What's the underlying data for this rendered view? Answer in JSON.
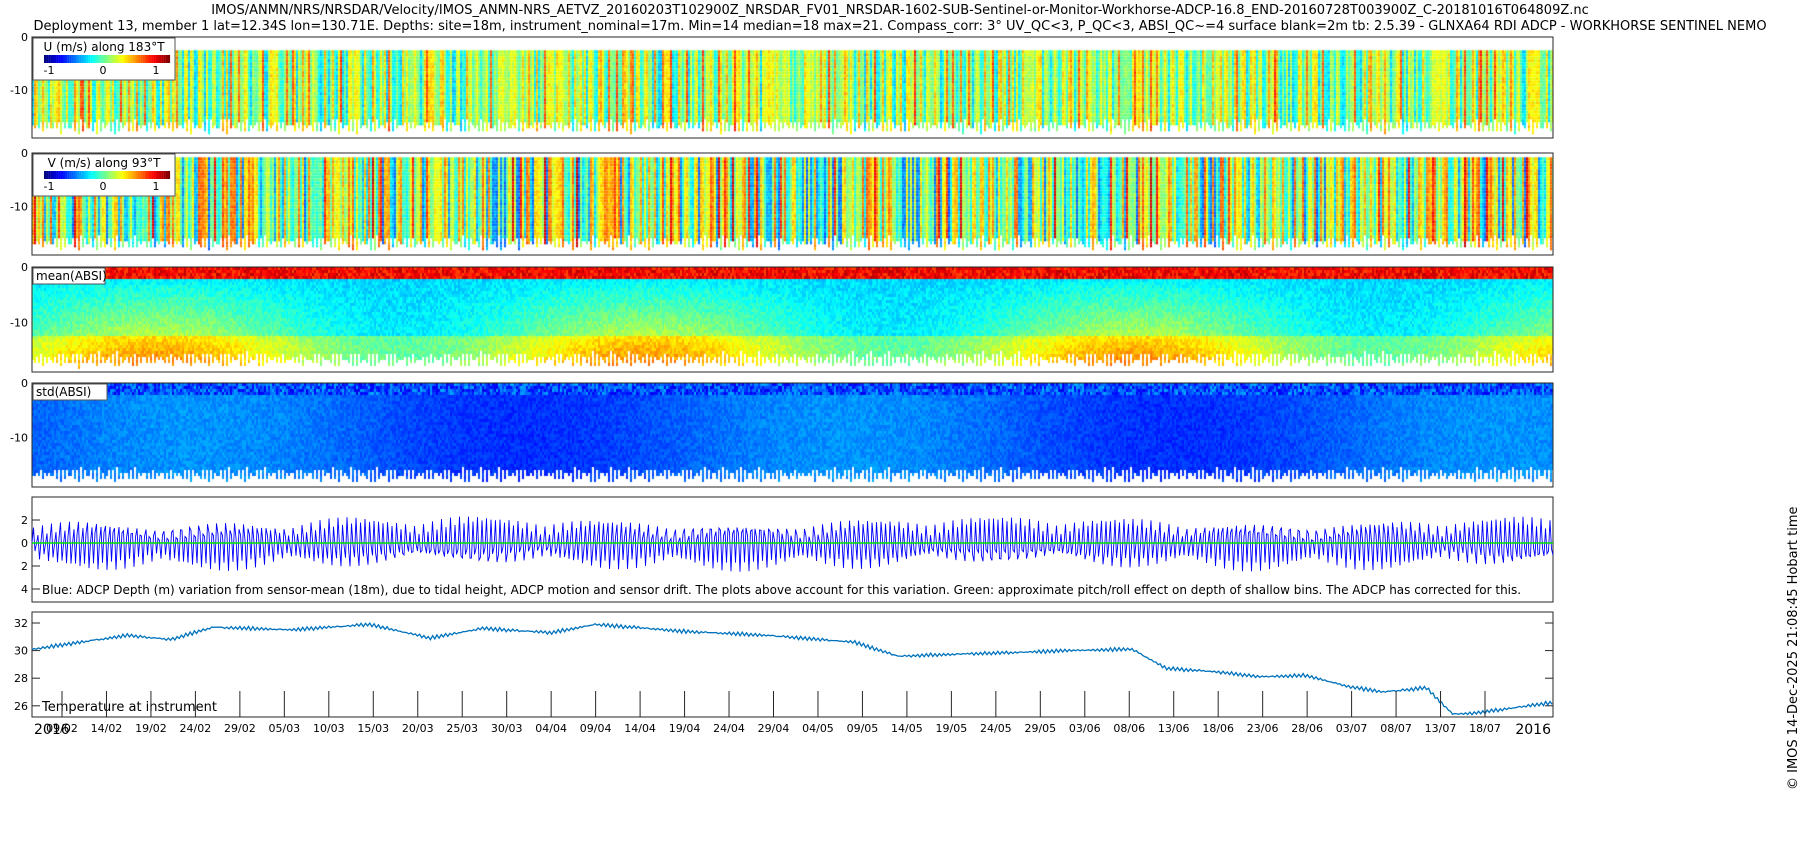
{
  "header": {
    "title": "IMOS/ANMN/NRS/NRSDAR/Velocity/IMOS_ANMN-NRS_AETVZ_20160203T102900Z_NRSDAR_FV01_NRSDAR-1602-SUB-Sentinel-or-Monitor-Workhorse-ADCP-16.8_END-20160728T003900Z_C-20181016T064809Z.nc",
    "subtitle": "Deployment 13, member 1 lat=12.34S lon=130.71E. Depths: site=18m, instrument_nominal=17m. Min=14 median=18 max=21. Compass_corr: 3° UV_QC<3, P_QC<3, ABSI_QC~=4 surface blank=2m tb: 2.5.39 - GLNXA64 RDI ADCP - WORKHORSE SENTINEL NEMO"
  },
  "credit": "© IMOS 14-Dec-2025 21:08:45 Hobart time",
  "chart_data": [
    {
      "type": "heatmap",
      "name": "U",
      "label": "U (m/s) along 183°T",
      "colorbar_ticks": [
        "-1",
        "0",
        "1"
      ],
      "clim": [
        -1.3,
        1.3
      ],
      "yticks": [
        "0",
        "-10"
      ],
      "ylim": [
        -19,
        0
      ],
      "colormap": "jet"
    },
    {
      "type": "heatmap",
      "name": "V",
      "label": "V (m/s) along 93°T",
      "colorbar_ticks": [
        "-1",
        "0",
        "1"
      ],
      "clim": [
        -1.3,
        1.3
      ],
      "yticks": [
        "0",
        "-10"
      ],
      "ylim": [
        -19,
        0
      ],
      "colormap": "jet"
    },
    {
      "type": "heatmap",
      "name": "meanABSI",
      "label": "mean(ABSI)",
      "yticks": [
        "0",
        "-10"
      ],
      "ylim": [
        -19,
        0
      ],
      "colormap": "jet"
    },
    {
      "type": "heatmap",
      "name": "stdABSI",
      "label": "std(ABSI)",
      "yticks": [
        "0",
        "-10"
      ],
      "ylim": [
        -19,
        0
      ],
      "colormap": "jet"
    },
    {
      "type": "line",
      "name": "depth",
      "yticks": [
        "2",
        "0",
        "2",
        "4"
      ],
      "ylim": [
        -4.5,
        3.8
      ],
      "series": [
        {
          "name": "ADCP depth variation",
          "color": "#0000ff",
          "amplitude_envelope_m": [
            2.2,
            3.3,
            1.0,
            2.9,
            1.2,
            3.3,
            1.0,
            3.0,
            1.1,
            3.4,
            1.0,
            2.9,
            1.0,
            3.2,
            1.0,
            2.8,
            1.0,
            2.8,
            1.0,
            2.9,
            1.0,
            3.0,
            1.0,
            2.9
          ]
        },
        {
          "name": "pitch/roll effect",
          "color": "#00e000"
        }
      ],
      "annotation": "Blue: ADCP Depth (m) variation from sensor-mean (18m), due to tidal height, ADCP motion and sensor drift. The plots above account for this variation. Green: approximate pitch/roll effect on depth of shallow bins. The ADCP has corrected for this."
    },
    {
      "type": "line",
      "name": "temperature",
      "label": "Temperature at instrument",
      "yticks": [
        "32",
        "30",
        "28",
        "26"
      ],
      "ylim": [
        25.2,
        32.8
      ],
      "color": "#0072bd",
      "x_days_from_start": [
        0,
        11,
        16,
        21,
        30,
        39,
        46,
        52,
        60,
        65,
        75,
        85,
        95,
        100,
        110,
        120,
        127,
        131,
        136,
        142,
        147,
        152,
        156,
        161,
        164,
        167,
        175
      ],
      "values": [
        30.1,
        31.1,
        30.8,
        31.7,
        31.5,
        31.9,
        30.9,
        31.6,
        31.3,
        31.9,
        31.4,
        31.1,
        30.6,
        29.6,
        29.8,
        30.0,
        30.1,
        28.7,
        28.5,
        28.1,
        28.2,
        27.4,
        27.0,
        27.3,
        25.4,
        25.5,
        26.2
      ]
    }
  ],
  "xaxis": {
    "start_label": "2016",
    "end_label": "2016",
    "ticks": [
      "09/02",
      "14/02",
      "19/02",
      "24/02",
      "29/02",
      "05/03",
      "10/03",
      "15/03",
      "20/03",
      "25/03",
      "30/03",
      "04/04",
      "09/04",
      "14/04",
      "19/04",
      "24/04",
      "29/04",
      "04/05",
      "09/05",
      "14/05",
      "19/05",
      "24/05",
      "29/05",
      "03/06",
      "08/06",
      "13/06",
      "18/06",
      "23/06",
      "28/06",
      "03/07",
      "08/07",
      "13/07",
      "18/07"
    ]
  }
}
